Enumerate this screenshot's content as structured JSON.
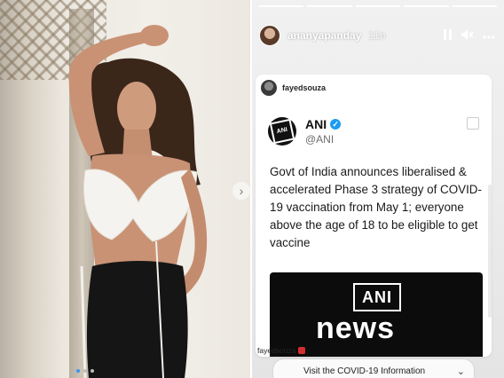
{
  "story": {
    "username": "ananyapanday",
    "time": "11h",
    "progress_segments": [
      {
        "state": "done"
      },
      {
        "state": "done"
      },
      {
        "state": "done"
      },
      {
        "state": "done"
      },
      {
        "state": "done"
      }
    ],
    "controls": {
      "pause_icon": "pause-icon",
      "sound_icon": "speaker-icon",
      "more_icon": "more-dots-icon"
    }
  },
  "repost": {
    "username": "fayedsouza"
  },
  "tweet": {
    "name": "ANI",
    "handle": "@ANI",
    "verified": true,
    "text": "Govt of India announces liberalised & accelerated Phase 3 strategy of COVID-19 vaccination from May 1; everyone above the age of 18 to be eligible to get vaccine"
  },
  "media": {
    "logo_text": "ANI",
    "word": "news"
  },
  "footer": {
    "username": "fayedsouza",
    "banner_text": "Visit the COVID-19 Information",
    "chevron_icon": "chevron-down-icon"
  },
  "left_photo": {
    "carousel_dots": [
      {
        "active": true
      },
      {
        "active": false
      },
      {
        "active": false
      }
    ],
    "arrow_icon": "chevron-right-icon"
  },
  "colors": {
    "story_bg": "#ececec",
    "verified_blue": "#1d9bf0",
    "news_bg": "#0c0c0c",
    "accent_dot": "#3897f0"
  }
}
